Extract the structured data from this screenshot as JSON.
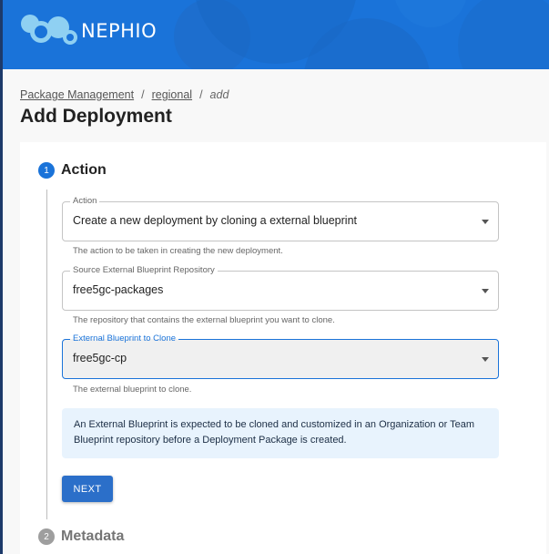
{
  "header": {
    "brand": "NEPHIO",
    "logo_icon": "nephio-logo-icon",
    "bg_color": "#1a73d9"
  },
  "breadcrumb": {
    "items": [
      "Package Management",
      "regional"
    ],
    "current": "add",
    "separator": "/"
  },
  "page": {
    "title": "Add Deployment"
  },
  "stepper": {
    "steps": [
      {
        "number": "1",
        "title": "Action",
        "state": "active"
      },
      {
        "number": "2",
        "title": "Metadata",
        "state": "inactive"
      }
    ]
  },
  "form": {
    "action": {
      "label": "Action",
      "value": "Create a new deployment by cloning a external blueprint",
      "helper": "The action to be taken in creating the new deployment."
    },
    "source_repo": {
      "label": "Source External Blueprint Repository",
      "value": "free5gc-packages",
      "helper": "The repository that contains the external blueprint you want to clone."
    },
    "blueprint": {
      "label": "External Blueprint to Clone",
      "value": "free5gc-cp",
      "helper": "The external blueprint to clone."
    },
    "info": "An External Blueprint is expected to be cloned and customized in an Organization or Team Blueprint repository before a Deployment Package is created.",
    "next_label": "NEXT"
  },
  "colors": {
    "primary": "#1a73d9",
    "info_bg": "#e8f3fd",
    "inactive": "#9e9e9e"
  }
}
